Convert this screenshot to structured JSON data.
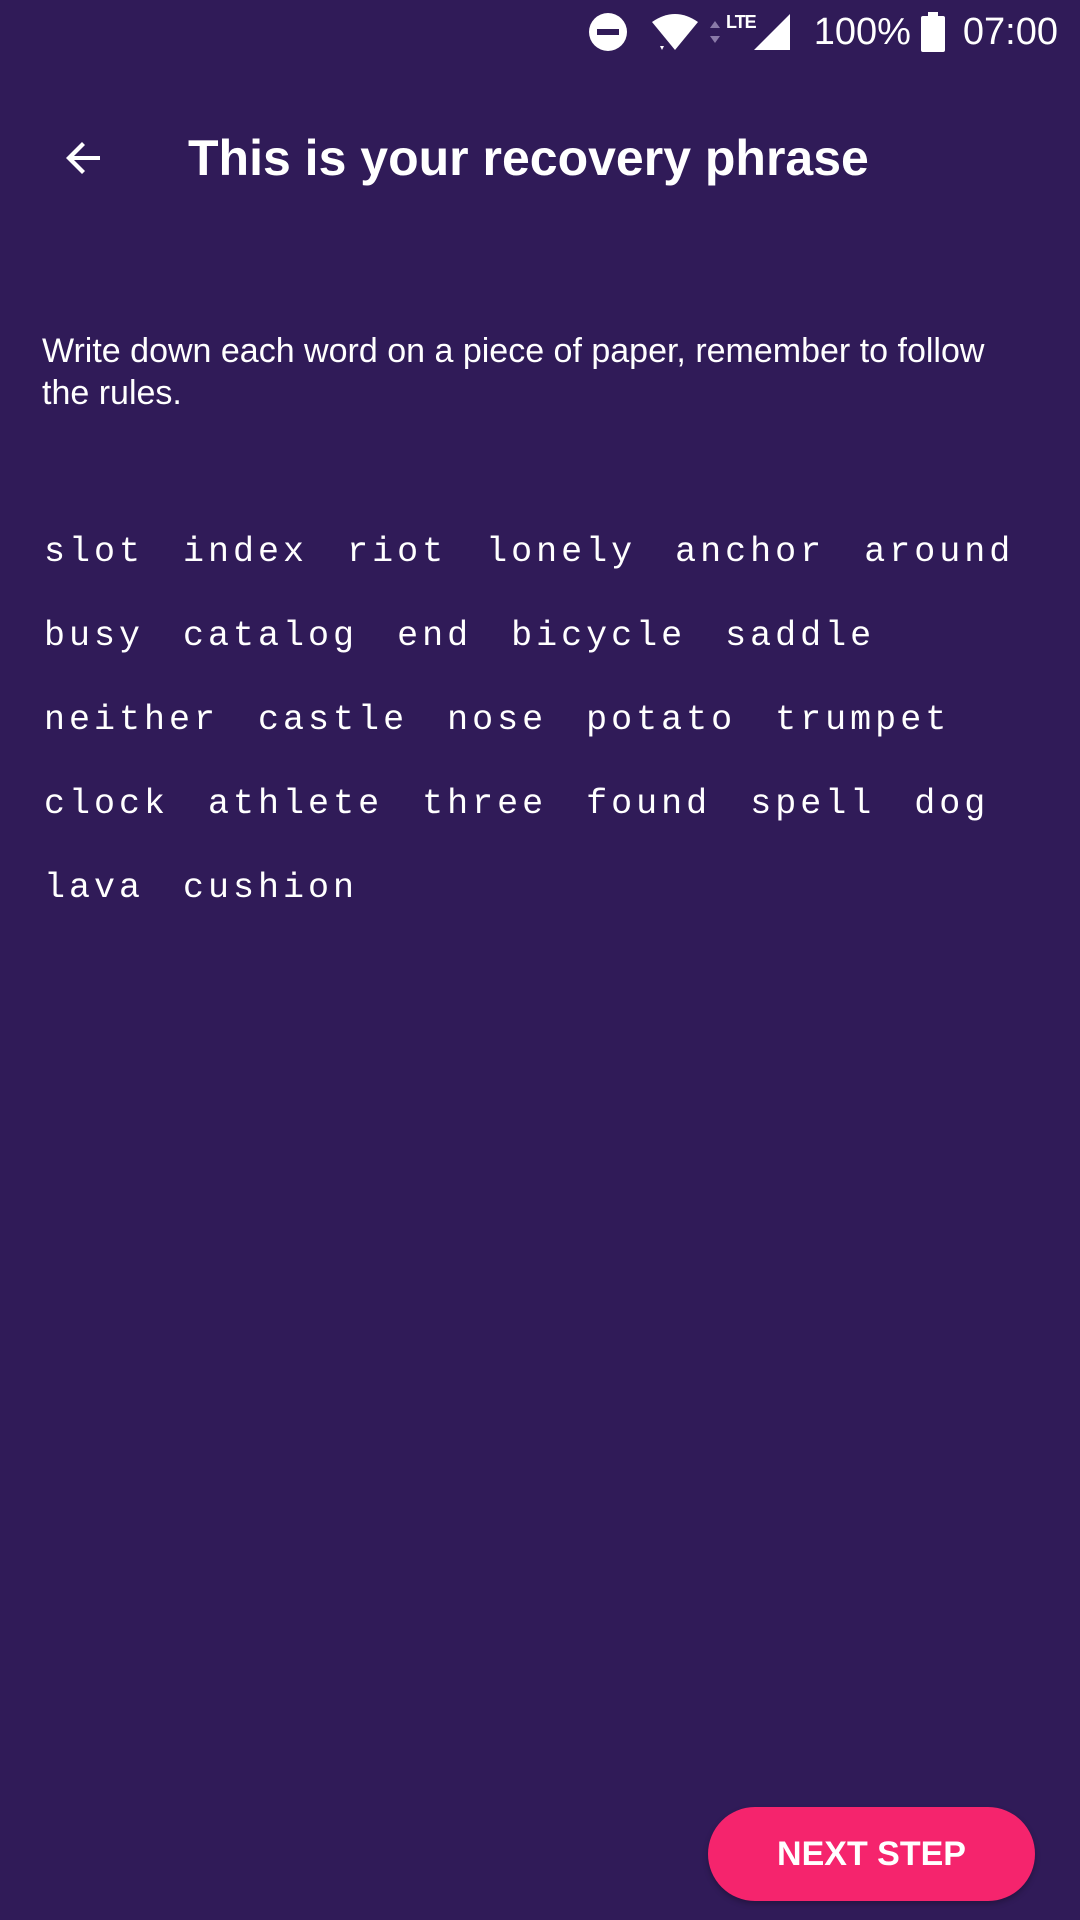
{
  "status_bar": {
    "network_type": "LTE",
    "battery_percent": "100%",
    "time": "07:00",
    "icons": [
      "do-not-disturb-icon",
      "wifi-icon",
      "data-arrows-icon",
      "signal-icon",
      "battery-icon"
    ]
  },
  "app_bar": {
    "back_icon": "arrow-back-icon",
    "title": "This is your recovery phrase"
  },
  "main": {
    "instructions": "Write down each word on a piece of paper, remember to follow the rules.",
    "recovery_words": [
      "slot",
      "index",
      "riot",
      "lonely",
      "anchor",
      "around",
      "busy",
      "catalog",
      "end",
      "bicycle",
      "saddle",
      "neither",
      "castle",
      "nose",
      "potato",
      "trumpet",
      "clock",
      "athlete",
      "three",
      "found",
      "spell",
      "dog",
      "lava",
      "cushion"
    ]
  },
  "footer": {
    "next_button_label": "NEXT STEP"
  },
  "colors": {
    "background": "#301b58",
    "accent": "#f5246d",
    "text": "#ffffff"
  }
}
